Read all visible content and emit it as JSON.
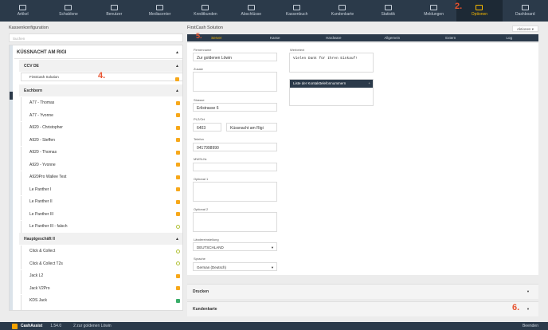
{
  "nav": [
    {
      "label": "Artikel",
      "icon": "box-icon"
    },
    {
      "label": "Schablone",
      "icon": "template-icon"
    },
    {
      "label": "Benutzer",
      "icon": "users-icon"
    },
    {
      "label": "Mediacenter",
      "icon": "media-icon"
    },
    {
      "label": "Kreditkunden",
      "icon": "credit-card-icon"
    },
    {
      "label": "Abschlüsse",
      "icon": "closing-icon"
    },
    {
      "label": "Kassenbuch",
      "icon": "cashbook-icon"
    },
    {
      "label": "Kundenkarte",
      "icon": "customer-card-icon"
    },
    {
      "label": "Statistik",
      "icon": "chart-icon"
    },
    {
      "label": "Meldungen",
      "icon": "mail-icon"
    },
    {
      "label": "Optionen",
      "icon": "gear-icon"
    },
    {
      "label": "Dashboard",
      "icon": "monitor-icon"
    }
  ],
  "markers": {
    "m2": "2.",
    "m4": "4.",
    "m5": "5.",
    "m6": "6."
  },
  "left": {
    "title": "Kassenkonfiguration",
    "search_placeholder": "Suchen"
  },
  "tree": {
    "root": "KÜSSNACHT AM RIGI",
    "ccv": "CCV DE",
    "firstcash": "FirstCash Solution",
    "eschborn": "Eschborn",
    "eschborn_items": [
      "A77 - Thomas",
      "A77 - Yvonne",
      "A920 - Christopher",
      "A920 - Steffen",
      "A920 - Thomas",
      "A920 - Yvonne",
      "A920Pro Wallee Test",
      "Le Panther I",
      "Le Panther II",
      "Le Panther III",
      "Le Panther III - falsch"
    ],
    "haupt": "Hauptgeschäft II",
    "haupt_items": [
      "Click & Collect",
      "Click & Collect T2s",
      "Jack L2",
      "Jack V2Pro",
      "KDS Jack"
    ],
    "more": "..."
  },
  "right": {
    "title": "FirstCash Solution",
    "actions_label": "Aktionen",
    "tabs": [
      "Server",
      "Kasse",
      "Hardware",
      "Allgemein",
      "Extern",
      "Log"
    ]
  },
  "form": {
    "firmenname_label": "Firmenname",
    "firmenname": "Zur goldenen Löwin",
    "zusatz_label": "Zusatz",
    "strasse_label": "Strasse",
    "strasse": "Erlistrasse 6",
    "plzort_label": "PLZ/Ort",
    "plz": "6403",
    "ort": "Küssnacht am Rigi",
    "telefon_label": "Telefon",
    "telefon": "0417998990",
    "mwst_label": "MWSt-Nr.",
    "optional1_label": "Optional 1",
    "optional2_label": "Optional 2",
    "land_label": "Ländereinstellung",
    "land": "DEUTSCHLAND",
    "sprache_label": "Sprache",
    "sprache": "German (Deutsch)",
    "werbe_label": "Werbetext",
    "werbe": "Vielen Dank für Ihren Einkauf!",
    "liste_label": "Liste der Kontakttelefonnummern",
    "plus": "+"
  },
  "sections": {
    "drucken": "Drucken",
    "kundenkarte": "Kundenkarte"
  },
  "status": {
    "brand": "CashAssist",
    "version": "1.54.0",
    "user": "2 zur goldenen Löwin",
    "right": "Beenden"
  },
  "colors": {
    "accent": "#f5b800",
    "nav": "#2b3a4a",
    "marker": "#e8532f"
  }
}
